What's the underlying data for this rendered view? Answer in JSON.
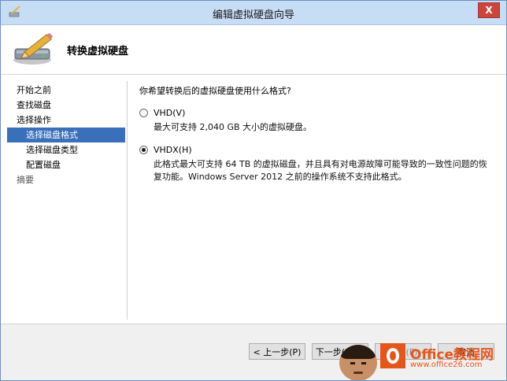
{
  "window": {
    "title": "编辑虚拟硬盘向导",
    "close_label": "X"
  },
  "header": {
    "title": "转换虚拟硬盘",
    "icon": "disk-pencil-icon"
  },
  "nav": {
    "items": [
      {
        "label": "开始之前",
        "level": 0,
        "state": "normal"
      },
      {
        "label": "查找磁盘",
        "level": 0,
        "state": "normal"
      },
      {
        "label": "选择操作",
        "level": 0,
        "state": "normal"
      },
      {
        "label": "选择磁盘格式",
        "level": 1,
        "state": "selected"
      },
      {
        "label": "选择磁盘类型",
        "level": 1,
        "state": "normal"
      },
      {
        "label": "配置磁盘",
        "level": 1,
        "state": "normal"
      },
      {
        "label": "摘要",
        "level": 0,
        "state": "disabled"
      }
    ]
  },
  "main": {
    "question": "你希望转换后的虚拟硬盘使用什么格式?",
    "options": [
      {
        "label": "VHD(V)",
        "checked": false,
        "description": "最大可支持 2,040 GB 大小的虚拟硬盘。"
      },
      {
        "label": "VHDX(H)",
        "checked": true,
        "description": "此格式最大可支持 64 TB 的虚拟磁盘，并且具有对电源故障可能导致的一致性问题的恢复功能。Windows Server 2012 之前的操作系统不支持此格式。"
      }
    ]
  },
  "footer": {
    "prev_label": "< 上一步(P)",
    "next_label": "下一步(N) >",
    "finish_label": "完成(F)",
    "cancel_label": "取消"
  },
  "watermark": {
    "brand": "Office教程网",
    "url": "www.office26.com"
  },
  "colors": {
    "titlebar": "#c7dcf5",
    "selected_nav": "#3a6fba",
    "close_button": "#c9463d",
    "brand": "#e3571d"
  }
}
